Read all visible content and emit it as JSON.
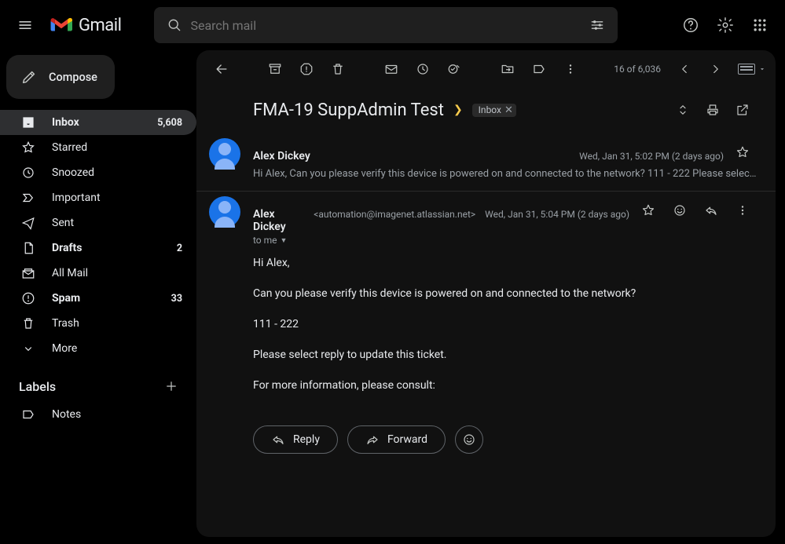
{
  "header": {
    "app_name": "Gmail",
    "search_placeholder": "Search mail"
  },
  "compose_label": "Compose",
  "nav": [
    {
      "key": "inbox",
      "label": "Inbox",
      "count": "5,608",
      "active": true,
      "bold": true
    },
    {
      "key": "starred",
      "label": "Starred",
      "count": "",
      "active": false,
      "bold": false
    },
    {
      "key": "snoozed",
      "label": "Snoozed",
      "count": "",
      "active": false,
      "bold": false
    },
    {
      "key": "important",
      "label": "Important",
      "count": "",
      "active": false,
      "bold": false
    },
    {
      "key": "sent",
      "label": "Sent",
      "count": "",
      "active": false,
      "bold": false
    },
    {
      "key": "drafts",
      "label": "Drafts",
      "count": "2",
      "active": false,
      "bold": true
    },
    {
      "key": "allmail",
      "label": "All Mail",
      "count": "",
      "active": false,
      "bold": false
    },
    {
      "key": "spam",
      "label": "Spam",
      "count": "33",
      "active": false,
      "bold": true
    },
    {
      "key": "trash",
      "label": "Trash",
      "count": "",
      "active": false,
      "bold": false
    },
    {
      "key": "more",
      "label": "More",
      "count": "",
      "active": false,
      "bold": false
    }
  ],
  "labels_header": "Labels",
  "user_labels": [
    {
      "label": "Notes"
    }
  ],
  "toolbar": {
    "position": "16 of 6,036"
  },
  "thread": {
    "subject": "FMA-19 SuppAdmin Test",
    "chip": "Inbox"
  },
  "messages": [
    {
      "sender": "Alex Dickey",
      "date": "Wed, Jan 31, 5:02 PM (2 days ago)",
      "snippet": "Hi Alex, Can you please verify this device is powered on and connected to the network? 111 - 222 Please select …"
    },
    {
      "sender": "Alex Dickey",
      "email": "<automation@imagenet.atlassian.net>",
      "date": "Wed, Jan 31, 5:04 PM (2 days ago)",
      "to": "to me",
      "body": [
        "Hi Alex,",
        "Can you please verify this device is powered on and connected to the network?",
        "111 - 222",
        "Please select reply to update this ticket.",
        "For more information, please consult:"
      ]
    }
  ],
  "actions": {
    "reply": "Reply",
    "forward": "Forward"
  }
}
